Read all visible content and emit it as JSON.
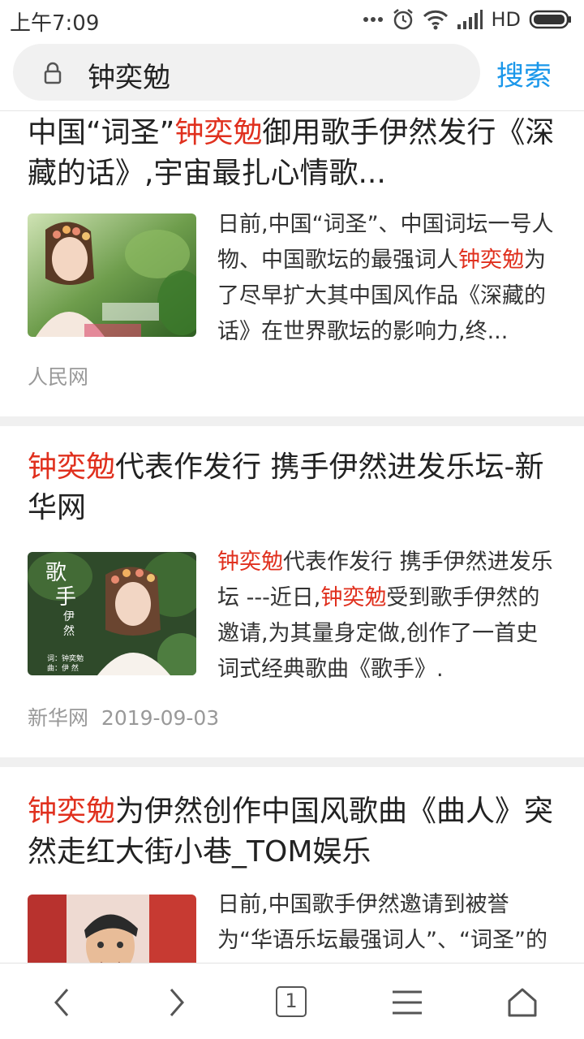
{
  "status": {
    "time": "上午7:09",
    "network": "HD"
  },
  "search": {
    "query": "钟奕勉",
    "button_label": "搜索"
  },
  "results": [
    {
      "title_pre": "中国“词圣”",
      "title_hl": "钟奕勉",
      "title_post": "御用歌手伊然发行《深藏的话》,宇宙最扎心情歌...",
      "snippet_pre": "日前,中国“词圣”、中国词坛一号人物、中国歌坛的最强词人",
      "snippet_hl": "钟奕勉",
      "snippet_post": "为了尽早扩大其中国风作品《深藏的话》在世界歌坛的影响力,终...",
      "source": "人民网",
      "date": ""
    },
    {
      "title_pre": "",
      "title_hl": "钟奕勉",
      "title_post": "代表作发行 携手伊然进发乐坛-新华网",
      "snippet_pre": "",
      "snippet_hl": "钟奕勉",
      "snippet_mid": "代表作发行 携手伊然进发乐坛 ---近日,",
      "snippet_hl2": "钟奕勉",
      "snippet_post": "受到歌手伊然的邀请,为其量身定做,创作了一首史词式经典歌曲《歌手》.",
      "source": "新华网",
      "date": "2019-09-03",
      "thumb_text": {
        "big": "歌",
        "big2": "手",
        "small": "伊",
        "small2": "然",
        "credit1": "词：钟奕勉",
        "credit2": "曲：伊 然"
      }
    },
    {
      "title_pre": "",
      "title_hl": "钟奕勉",
      "title_post": "为伊然创作中国风歌曲《曲人》突然走红大街小巷_TOM娱乐",
      "snippet_pre": "日前,中国歌手伊然邀请到被誉为“华语乐坛最强词人”、“词圣”的",
      "source": "",
      "date": ""
    }
  ],
  "tabs": {
    "count": "1"
  },
  "colors": {
    "accent": "#1a97ea",
    "highlight": "#e0301e"
  }
}
